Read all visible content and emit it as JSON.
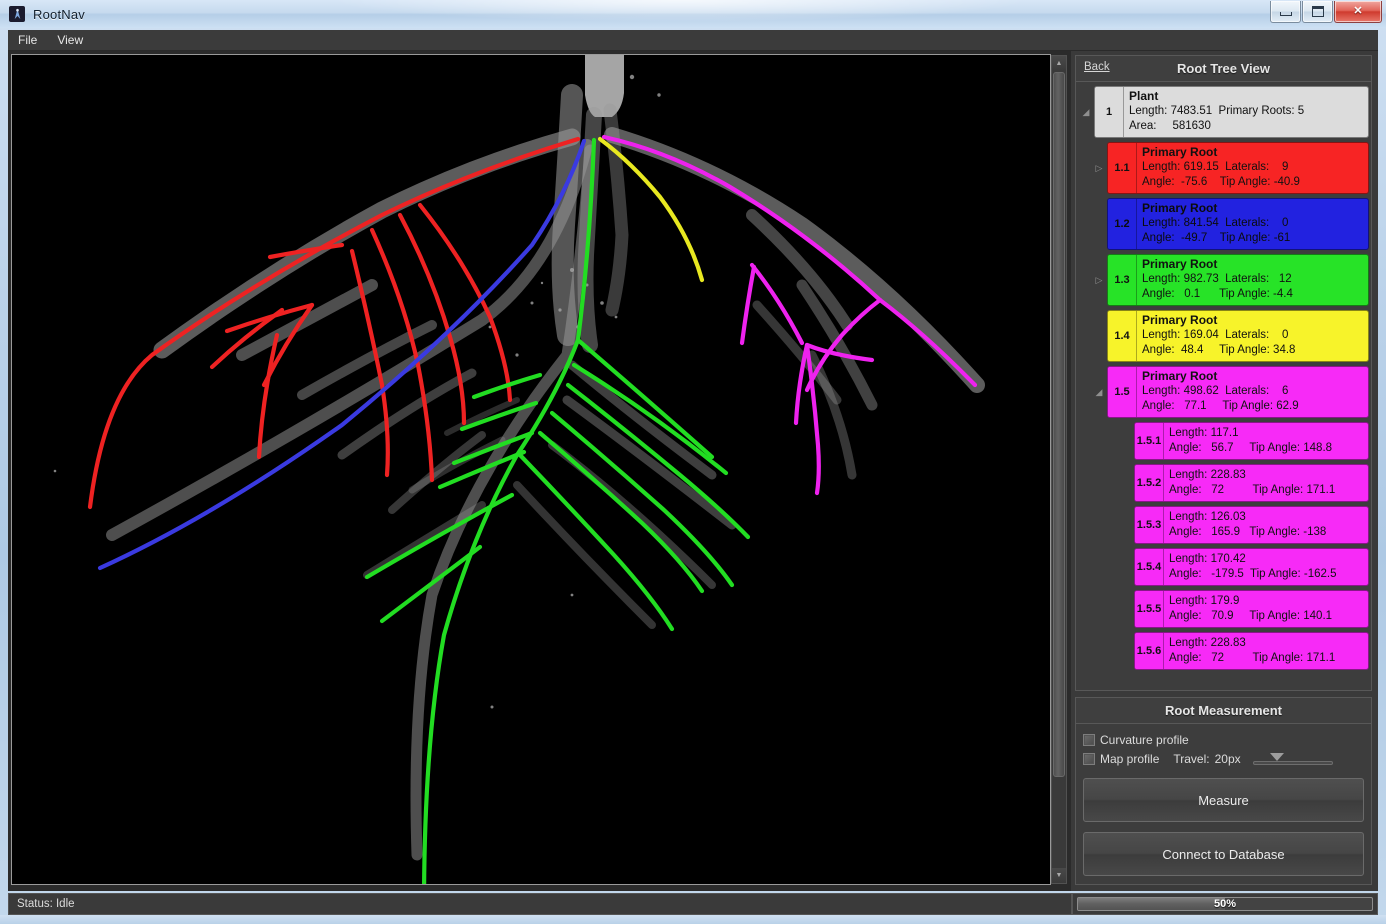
{
  "window": {
    "title": "RootNav",
    "icon": "rootnav-logo-icon",
    "minimize_label": "Minimize",
    "maximize_label": "Maximize",
    "close_label": "✕"
  },
  "menu": {
    "items": [
      {
        "label": "File"
      },
      {
        "label": "View"
      }
    ]
  },
  "tree_panel": {
    "back_label": "Back",
    "title": "Root Tree View",
    "nodes": [
      {
        "id": "1",
        "color_class": "plant",
        "color": "#dcdcdc",
        "expander": "collapse",
        "title": "Plant",
        "line1": "Length: 7483.51  Primary Roots: 5",
        "line2": "Area:     581630",
        "indent": 0,
        "kind": "plant"
      },
      {
        "id": "1.1",
        "color_class": "red",
        "color": "#f72424",
        "expander": "expand",
        "title": "Primary Root",
        "line1": "Length: 619.15  Laterals:    9",
        "line2": "Angle:  -75.6    Tip Angle: -40.9",
        "indent": 1,
        "kind": "primary"
      },
      {
        "id": "1.2",
        "color_class": "blue",
        "color": "#2222e0",
        "expander": "none",
        "title": "Primary Root",
        "line1": "Length: 841.54  Laterals:    0",
        "line2": "Angle:  -49.7    Tip Angle: -61",
        "indent": 1,
        "kind": "primary"
      },
      {
        "id": "1.3",
        "color_class": "green",
        "color": "#27e327",
        "expander": "expand",
        "title": "Primary Root",
        "line1": "Length: 982.73  Laterals:   12",
        "line2": "Angle:   0.1      Tip Angle: -4.4",
        "indent": 1,
        "kind": "primary"
      },
      {
        "id": "1.4",
        "color_class": "yellow",
        "color": "#f7f32a",
        "expander": "none",
        "title": "Primary Root",
        "line1": "Length: 169.04  Laterals:    0",
        "line2": "Angle:  48.4     Tip Angle: 34.8",
        "indent": 1,
        "kind": "primary"
      },
      {
        "id": "1.5",
        "color_class": "magenta",
        "color": "#f72af7",
        "expander": "collapse",
        "title": "Primary Root",
        "line1": "Length: 498.62  Laterals:    6",
        "line2": "Angle:   77.1     Tip Angle: 62.9",
        "indent": 1,
        "kind": "primary"
      },
      {
        "id": "1.5.1",
        "color_class": "magenta",
        "color": "#f72af7",
        "expander": "none",
        "title": "",
        "line1": "Length: 117.1",
        "line2": "Angle:   56.7     Tip Angle: 148.8",
        "indent": 2,
        "kind": "lateral"
      },
      {
        "id": "1.5.2",
        "color_class": "magenta",
        "color": "#f72af7",
        "expander": "none",
        "title": "",
        "line1": "Length: 228.83",
        "line2": "Angle:   72         Tip Angle: 171.1",
        "indent": 2,
        "kind": "lateral"
      },
      {
        "id": "1.5.3",
        "color_class": "magenta",
        "color": "#f72af7",
        "expander": "none",
        "title": "",
        "line1": "Length: 126.03",
        "line2": "Angle:   165.9   Tip Angle: -138",
        "indent": 2,
        "kind": "lateral"
      },
      {
        "id": "1.5.4",
        "color_class": "magenta",
        "color": "#f72af7",
        "expander": "none",
        "title": "",
        "line1": "Length: 170.42",
        "line2": "Angle:   -179.5  Tip Angle: -162.5",
        "indent": 2,
        "kind": "lateral"
      },
      {
        "id": "1.5.5",
        "color_class": "magenta",
        "color": "#f72af7",
        "expander": "none",
        "title": "",
        "line1": "Length: 179.9",
        "line2": "Angle:   70.9     Tip Angle: 140.1",
        "indent": 2,
        "kind": "lateral"
      },
      {
        "id": "1.5.6",
        "color_class": "magenta",
        "color": "#f72af7",
        "expander": "none",
        "title": "",
        "line1": "Length: 228.83",
        "line2": "Angle:   72         Tip Angle: 171.1",
        "indent": 2,
        "kind": "lateral"
      }
    ]
  },
  "measurement_panel": {
    "title": "Root Measurement",
    "curvature_profile_label": "Curvature profile",
    "curvature_profile_checked": false,
    "map_profile_label": "Map profile",
    "map_profile_checked": false,
    "travel_label": "Travel:",
    "travel_value": "20px",
    "measure_button": "Measure",
    "connect_button": "Connect to Database"
  },
  "statusbar": {
    "status_text": "Status: Idle",
    "progress_label": "50%",
    "progress_percent": 50
  },
  "canvas": {
    "background": "#000000",
    "root_colors": {
      "primary_1_1": "#ee2222",
      "primary_1_2": "#3333dd",
      "primary_1_3": "#22dd22",
      "primary_1_4": "#e8e820",
      "primary_1_5": "#ee22ee",
      "raw_mask": "#b0b0b0"
    }
  }
}
